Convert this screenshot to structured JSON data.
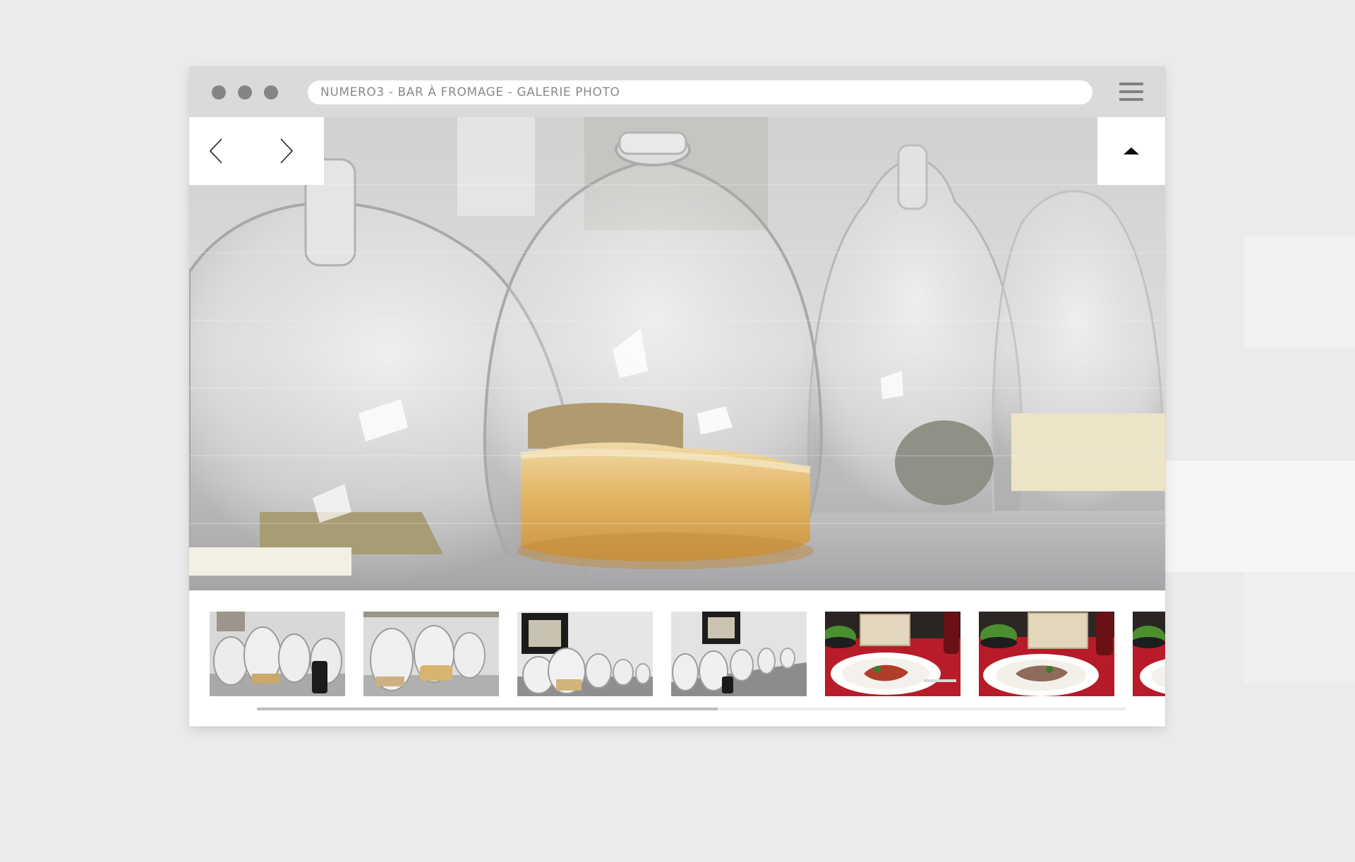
{
  "window": {
    "url_title": "NUMERO3 - BAR À FROMAGE - GALERIE PHOTO"
  },
  "controls": {
    "prev_icon": "chevron-left-icon",
    "next_icon": "chevron-right-icon",
    "up_icon": "triangle-up-icon",
    "menu_icon": "hamburger-menu-icon"
  },
  "gallery": {
    "main_photo": "cheese-under-glass-cloche",
    "thumbnails": [
      {
        "subject": "glass-cloches-with-cheese"
      },
      {
        "subject": "glass-cloches-with-cheese"
      },
      {
        "subject": "cloches-and-framed-picture"
      },
      {
        "subject": "cloches-and-framed-picture"
      },
      {
        "subject": "plated-dish-with-salad"
      },
      {
        "subject": "plated-dish-with-salad"
      },
      {
        "subject": "plated-dish-with-salad"
      }
    ],
    "scroll_progress": 0.53
  },
  "colors": {
    "page_background": "#ebebed",
    "titlebar": "#dadadb",
    "window_dots": "#858586",
    "accent_red": "#c81e2a"
  }
}
